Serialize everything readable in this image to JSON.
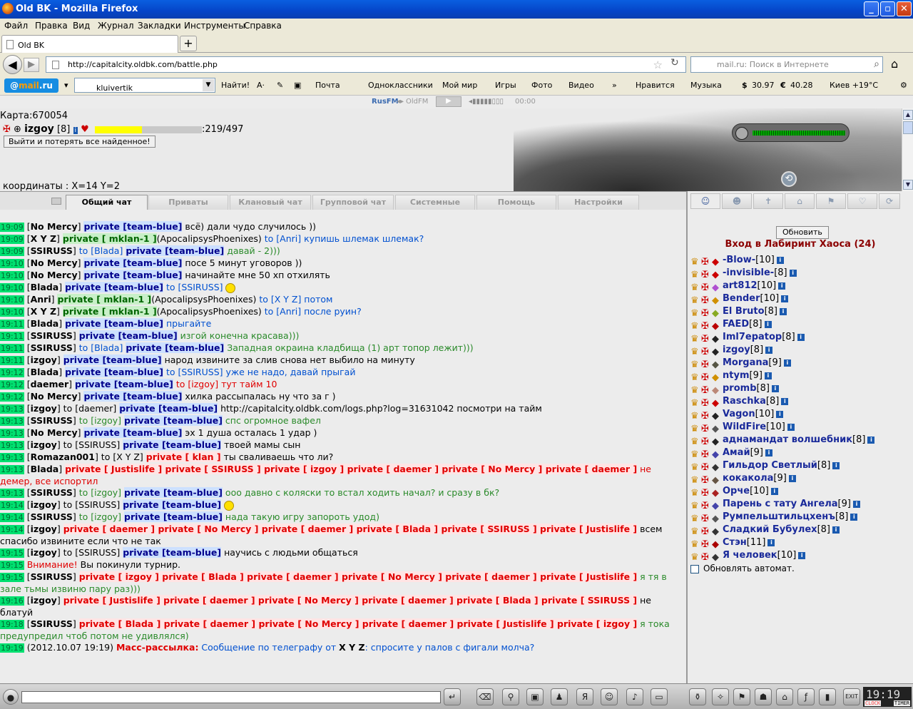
{
  "window": {
    "title": "Old BK - Mozilla Firefox"
  },
  "menu": [
    "Файл",
    "Правка",
    "Вид",
    "Журнал",
    "Закладки",
    "Инструменты",
    "Справка"
  ],
  "tab": {
    "title": "Old BK",
    "new_tab": "+"
  },
  "nav": {
    "url": "http://capitalcity.oldbk.com/battle.php",
    "search_placeholder": "mail.ru: Поиск в Интернете"
  },
  "mailbar": {
    "logo": "@mail.ru",
    "login": "kluivertik",
    "find": "Найти!",
    "items": [
      "Почта",
      "Одноклассники",
      "Мой мир",
      "Игры",
      "Фото",
      "Видео",
      "»",
      "Нравится",
      "Музыка",
      "30.97",
      "40.28",
      "Киев +19°C"
    ],
    "dollar": "$",
    "euro": "€"
  },
  "radio": {
    "name": "RusFM",
    "sep": "◂▸",
    "name2": "OldFM",
    "time": "00:00"
  },
  "game": {
    "card": "Карта:670054",
    "char_name": "izgoy",
    "char_level": "[8]",
    "hp_text": ":219/497",
    "hp_fraction": 0.44,
    "exit_button": "Выйти и потерять все найденное!",
    "coords": "координаты : X=14 Y=2"
  },
  "chat_tabs": [
    "Общий чат",
    "Приваты",
    "Клановый чат",
    "Групповой чат",
    "Системные",
    "Помощь",
    "Настройки"
  ],
  "chat": [
    {
      "t": "19:09",
      "parts": [
        [
          "nk",
          "["
        ],
        [
          "nkb",
          "No Mercy"
        ],
        [
          "nk",
          "] "
        ],
        [
          "pb",
          "private [team-blue]"
        ],
        [
          "tdark",
          " всё) дали чудо случилось ))"
        ]
      ]
    },
    {
      "t": "19:09",
      "parts": [
        [
          "nk",
          "["
        ],
        [
          "nkb",
          "X Y Z"
        ],
        [
          "nk",
          "] "
        ],
        [
          "pg",
          "private [ mklan-1 ]"
        ],
        [
          "tdark",
          "(ApocalipsysPhoenixes) "
        ],
        [
          "tblue",
          "to [Anri] купишь шлемак шлемак?"
        ]
      ]
    },
    {
      "t": "19:09",
      "parts": [
        [
          "nk",
          "["
        ],
        [
          "nkb",
          "SSIRUSS"
        ],
        [
          "nk",
          "] "
        ],
        [
          "tblue",
          "to [Blada] "
        ],
        [
          "pb",
          "private [team-blue]"
        ],
        [
          "tgreen",
          " давай - 2)))"
        ]
      ]
    },
    {
      "t": "19:10",
      "parts": [
        [
          "nk",
          "["
        ],
        [
          "nkb",
          "No Mercy"
        ],
        [
          "nk",
          "] "
        ],
        [
          "pb",
          "private [team-blue]"
        ],
        [
          "tdark",
          " посе 5 минут уговоров ))"
        ]
      ]
    },
    {
      "t": "19:10",
      "parts": [
        [
          "nk",
          "["
        ],
        [
          "nkb",
          "No Mercy"
        ],
        [
          "nk",
          "] "
        ],
        [
          "pb",
          "private [team-blue]"
        ],
        [
          "tdark",
          " начинайте мне 50 хп отхилять"
        ]
      ]
    },
    {
      "t": "19:10",
      "parts": [
        [
          "nk",
          "["
        ],
        [
          "nkb",
          "Blada"
        ],
        [
          "nk",
          "] "
        ],
        [
          "pb",
          "private [team-blue]"
        ],
        [
          "tblue",
          " to [SSIRUSS] "
        ],
        [
          "smile",
          ""
        ]
      ]
    },
    {
      "t": "19:10",
      "parts": [
        [
          "nk",
          "["
        ],
        [
          "nkb",
          "Anri"
        ],
        [
          "nk",
          "] "
        ],
        [
          "pg",
          "private [ mklan-1 ]"
        ],
        [
          "tdark",
          "(ApocalipsysPhoenixes) "
        ],
        [
          "tblue",
          "to [X Y Z] потом"
        ]
      ]
    },
    {
      "t": "19:10",
      "parts": [
        [
          "nk",
          "["
        ],
        [
          "nkb",
          "X Y Z"
        ],
        [
          "nk",
          "] "
        ],
        [
          "pg",
          "private [ mklan-1 ]"
        ],
        [
          "tdark",
          "(ApocalipsysPhoenixes) "
        ],
        [
          "tblue",
          "to [Anri] после руин?"
        ]
      ]
    },
    {
      "t": "19:11",
      "parts": [
        [
          "nk",
          "["
        ],
        [
          "nkb",
          "Blada"
        ],
        [
          "nk",
          "] "
        ],
        [
          "pb",
          "private [team-blue]"
        ],
        [
          "tblue",
          " прыгайте"
        ]
      ]
    },
    {
      "t": "19:11",
      "parts": [
        [
          "nk",
          "["
        ],
        [
          "nkb",
          "SSIRUSS"
        ],
        [
          "nk",
          "] "
        ],
        [
          "pb",
          "private [team-blue]"
        ],
        [
          "tgreen",
          " изгой конечна красава)))"
        ]
      ]
    },
    {
      "t": "19:11",
      "parts": [
        [
          "nk",
          "["
        ],
        [
          "nkb",
          "SSIRUSS"
        ],
        [
          "nk",
          "] "
        ],
        [
          "tblue",
          "to [Blada] "
        ],
        [
          "pb",
          "private [team-blue]"
        ],
        [
          "tgreen",
          " Западная окраина кладбища (1) арт топор лежит)))"
        ]
      ]
    },
    {
      "t": "19:11",
      "parts": [
        [
          "nk",
          "["
        ],
        [
          "nkb",
          "izgoy"
        ],
        [
          "nk",
          "] "
        ],
        [
          "pb",
          "private [team-blue]"
        ],
        [
          "tdark",
          " народ извините за слив снова нет выбило на минуту"
        ]
      ]
    },
    {
      "t": "19:12",
      "parts": [
        [
          "nk",
          "["
        ],
        [
          "nkb",
          "Blada"
        ],
        [
          "nk",
          "] "
        ],
        [
          "pb",
          "private [team-blue]"
        ],
        [
          "tblue",
          " to [SSIRUSS] уже не надо, давай прыгай"
        ]
      ]
    },
    {
      "t": "19:12",
      "parts": [
        [
          "nk",
          "["
        ],
        [
          "nkb",
          "daemer"
        ],
        [
          "nk",
          "] "
        ],
        [
          "pb",
          "private [team-blue]"
        ],
        [
          "tred",
          " to [izgoy] тут тайм 10"
        ]
      ]
    },
    {
      "t": "19:12",
      "parts": [
        [
          "nk",
          "["
        ],
        [
          "nkb",
          "No Mercy"
        ],
        [
          "nk",
          "] "
        ],
        [
          "pb",
          "private [team-blue]"
        ],
        [
          "tdark",
          " хилка рассыпалась ну что за г )"
        ]
      ]
    },
    {
      "t": "19:13",
      "parts": [
        [
          "nk",
          "["
        ],
        [
          "nkb",
          "izgoy"
        ],
        [
          "nk",
          "] to [daemer] "
        ],
        [
          "pb",
          "private [team-blue]"
        ],
        [
          "tdark",
          " http://capitalcity.oldbk.com/logs.php?log=31631042 посмотри на тайм"
        ]
      ]
    },
    {
      "t": "19:13",
      "parts": [
        [
          "nk",
          "["
        ],
        [
          "nkb",
          "SSIRUSS"
        ],
        [
          "nk",
          "] "
        ],
        [
          "tgreen",
          "to [izgoy] "
        ],
        [
          "pb",
          "private [team-blue]"
        ],
        [
          "tgreen",
          " спс огромное вафел"
        ]
      ]
    },
    {
      "t": "19:13",
      "parts": [
        [
          "nk",
          "["
        ],
        [
          "nkb",
          "No Mercy"
        ],
        [
          "nk",
          "] "
        ],
        [
          "pb",
          "private [team-blue]"
        ],
        [
          "tdark",
          " эх 1 душа осталась 1 удар )"
        ]
      ]
    },
    {
      "t": "19:13",
      "parts": [
        [
          "nk",
          "["
        ],
        [
          "nkb",
          "izgoy"
        ],
        [
          "nk",
          "] to [SSIRUSS] "
        ],
        [
          "pb",
          "private [team-blue]"
        ],
        [
          "tdark",
          " твоей мамы сын"
        ]
      ]
    },
    {
      "t": "19:13",
      "parts": [
        [
          "nk",
          "["
        ],
        [
          "nkb",
          "Romazan001"
        ],
        [
          "nk",
          "] to [X Y Z] "
        ],
        [
          "pr",
          "private [ klan ]"
        ],
        [
          "tdark",
          " ты сваливаешь что ли?"
        ]
      ]
    },
    {
      "t": "19:13",
      "wrap": true,
      "parts": [
        [
          "nk",
          "["
        ],
        [
          "nkb",
          "Blada"
        ],
        [
          "nk",
          "] "
        ],
        [
          "pr",
          "private [ Justislife ] private [ SSIRUSS ] private [ izgoy ] private [ daemer ] private [ No Mercy ] private [ daemer ]"
        ],
        [
          "tred",
          " не демер, все испортил"
        ]
      ]
    },
    {
      "t": "19:13",
      "parts": [
        [
          "nk",
          "["
        ],
        [
          "nkb",
          "SSIRUSS"
        ],
        [
          "nk",
          "] "
        ],
        [
          "tgreen",
          "to [izgoy] "
        ],
        [
          "pb",
          "private [team-blue]"
        ],
        [
          "tgreen",
          " ооо давно с коляски то встал ходить начал? и сразу в бк?"
        ]
      ]
    },
    {
      "t": "19:14",
      "parts": [
        [
          "nk",
          "["
        ],
        [
          "nkb",
          "izgoy"
        ],
        [
          "nk",
          "] to [SSIRUSS] "
        ],
        [
          "pb",
          "private [team-blue]"
        ],
        [
          "tdark",
          " "
        ],
        [
          "smile",
          ""
        ]
      ]
    },
    {
      "t": "19:14",
      "parts": [
        [
          "nk",
          "["
        ],
        [
          "nkb",
          "SSIRUSS"
        ],
        [
          "nk",
          "] "
        ],
        [
          "tgreen",
          "to [izgoy] "
        ],
        [
          "pb",
          "private [team-blue]"
        ],
        [
          "tgreen",
          " нада такую игру запороть удод)"
        ]
      ]
    },
    {
      "t": "19:14",
      "wrap": true,
      "parts": [
        [
          "nk",
          "["
        ],
        [
          "nkb",
          "izgoy"
        ],
        [
          "nk",
          "] "
        ],
        [
          "pr",
          "private [ daemer ] private [ No Mercy ] private [ daemer ] private [ Blada ] private [ SSIRUSS ] private [ Justislife ]"
        ],
        [
          "tdark",
          " всем спасибо извините если что не так"
        ]
      ]
    },
    {
      "t": "19:15",
      "parts": [
        [
          "nk",
          "["
        ],
        [
          "nkb",
          "izgoy"
        ],
        [
          "nk",
          "] to [SSIRUSS] "
        ],
        [
          "pb",
          "private [team-blue]"
        ],
        [
          "tdark",
          " научись с людьми общаться"
        ]
      ]
    },
    {
      "t": "19:15",
      "parts": [
        [
          "tred",
          "Внимание!"
        ],
        [
          "tdark",
          " Вы покинули турнир."
        ]
      ]
    },
    {
      "t": "19:15",
      "wrap": true,
      "parts": [
        [
          "nk",
          "["
        ],
        [
          "nkb",
          "SSIRUSS"
        ],
        [
          "nk",
          "] "
        ],
        [
          "pr",
          "private [ izgoy ] private [ Blada ] private [ daemer ] private [ No Mercy ] private [ daemer ] private [ Justislife ]"
        ],
        [
          "tgreen",
          " я тя в зале тьмы извиню пару раз)))"
        ]
      ]
    },
    {
      "t": "19:16",
      "wrap": true,
      "parts": [
        [
          "nk",
          "["
        ],
        [
          "nkb",
          "izgoy"
        ],
        [
          "nk",
          "] "
        ],
        [
          "pr",
          "private [ Justislife ] private [ daemer ] private [ No Mercy ] private [ daemer ] private [ Blada ] private [ SSIRUSS ]"
        ],
        [
          "tdark",
          " не блатуй"
        ]
      ]
    },
    {
      "t": "19:18",
      "wrap": true,
      "parts": [
        [
          "nk",
          "["
        ],
        [
          "nkb",
          "SSIRUSS"
        ],
        [
          "nk",
          "] "
        ],
        [
          "pr",
          "private [ Blada ] private [ daemer ] private [ No Mercy ] private [ daemer ] private [ Justislife ] private [ izgoy ]"
        ],
        [
          "tgreen",
          " я тока предупредил чтоб потом не удивлялся)"
        ]
      ]
    },
    {
      "t": "19:19",
      "parts": [
        [
          "nk",
          "(2012.10.07 19:19) "
        ],
        [
          "tredb",
          "Масс-рассылка:"
        ],
        [
          "tblue",
          " Сообщение по телеграфу от "
        ],
        [
          "nkb",
          "X Y Z"
        ],
        [
          "tblue",
          ": спросите у палов с фигали молча?"
        ]
      ]
    }
  ],
  "right": {
    "refresh": "Обновить",
    "location": "Вход в Лабиринт Хаоса (24)",
    "users": [
      {
        "name": "-Blow-",
        "lvl": "[10]"
      },
      {
        "name": "-invisible-",
        "lvl": "[8]"
      },
      {
        "name": "art812",
        "lvl": "[10]"
      },
      {
        "name": "Bender",
        "lvl": "[10]"
      },
      {
        "name": "El Bruto",
        "lvl": "[8]"
      },
      {
        "name": "FAED",
        "lvl": "[8]"
      },
      {
        "name": "Iml7epatop",
        "lvl": "[8]"
      },
      {
        "name": "izgoy",
        "lvl": "[8]"
      },
      {
        "name": "Morgana",
        "lvl": "[9]"
      },
      {
        "name": "ntym",
        "lvl": "[9]"
      },
      {
        "name": "promb",
        "lvl": "[8]"
      },
      {
        "name": "Raschka",
        "lvl": "[8]"
      },
      {
        "name": "Vagon",
        "lvl": "[10]"
      },
      {
        "name": "WildFire",
        "lvl": "[10]"
      },
      {
        "name": "аднамандат волшебник",
        "lvl": "[8]"
      },
      {
        "name": "Амай",
        "lvl": "[9]"
      },
      {
        "name": "Гильдор Светлый",
        "lvl": "[8]"
      },
      {
        "name": "кокакола",
        "lvl": "[9]"
      },
      {
        "name": "Орче",
        "lvl": "[10]"
      },
      {
        "name": "Парень с тату Ангела",
        "lvl": "[9]"
      },
      {
        "name": "Румпельштильцхенъ",
        "lvl": "[8]"
      },
      {
        "name": "Сладкий Бубулех",
        "lvl": "[8]"
      },
      {
        "name": "Стэн",
        "lvl": "[11]"
      },
      {
        "name": "Я человек",
        "lvl": "[10]"
      }
    ],
    "auto_update": "Обновлять автомат."
  },
  "clock": {
    "time": "19:19",
    "l1": "CLOCK",
    "l2": "TIMER",
    "exit": "EXIT"
  }
}
